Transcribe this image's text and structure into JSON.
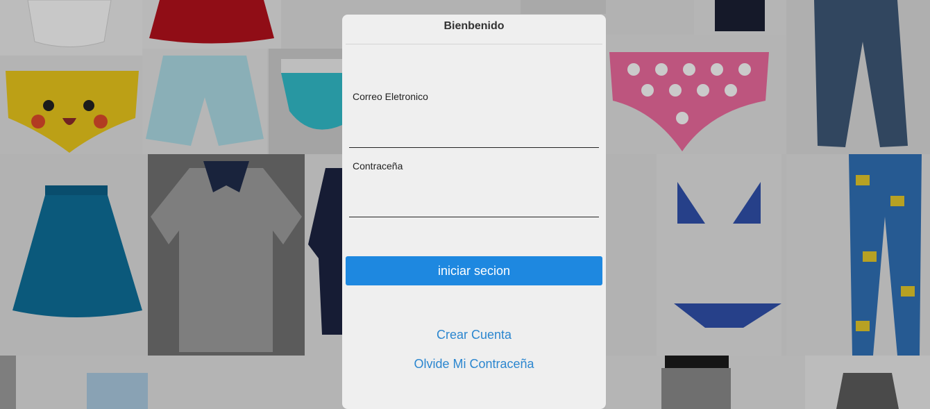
{
  "modal": {
    "title": "Bienbenido",
    "email_label": "Correo Eletronico",
    "email_value": "",
    "password_label": "Contraceña",
    "password_value": "",
    "login_label": "iniciar secion",
    "create_account_label": "Crear Cuenta",
    "forgot_password_label": "Olvide Mi Contraceña"
  },
  "colors": {
    "primary": "#1e88e0",
    "link": "#2b86cf",
    "modal_bg": "#efefef"
  }
}
